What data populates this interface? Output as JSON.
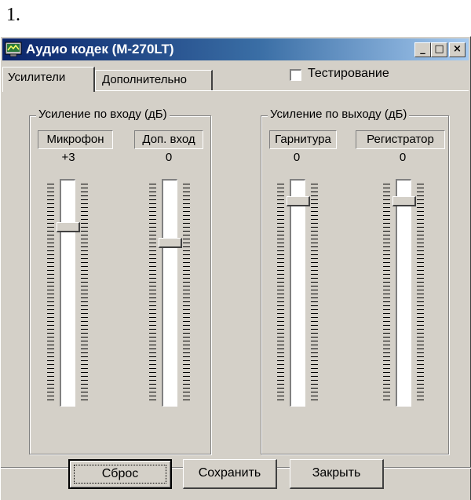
{
  "document": {
    "number_label": "1."
  },
  "window": {
    "title": "Аудио кодек (М-270LT)",
    "controls": {
      "minimize": "_",
      "maximize": "□",
      "close": "×"
    }
  },
  "tabs": [
    {
      "label": "Усилители",
      "active": true
    },
    {
      "label": "Дополнительно",
      "active": false
    }
  ],
  "testing": {
    "label": "Тестирование",
    "checked": false
  },
  "input_group": {
    "legend": "Усиление по входу (дБ)",
    "channels": [
      {
        "label": "Микрофон",
        "value": "+3",
        "level_fraction": 0.2
      },
      {
        "label": "Доп. вход",
        "value": "0",
        "level_fraction": 0.27
      }
    ]
  },
  "output_group": {
    "legend": "Усиление по выходу (дБ)",
    "channels": [
      {
        "label": "Гарнитура",
        "value": "0",
        "level_fraction": 0.08
      },
      {
        "label": "Регистратор",
        "value": "0",
        "level_fraction": 0.08
      }
    ]
  },
  "buttons": {
    "reset": "Сброс",
    "save": "Сохранить",
    "close": "Закрыть"
  },
  "colors": {
    "window_face": "#d4d0c8",
    "title_start": "#0a246a",
    "title_end": "#a6caf0"
  }
}
